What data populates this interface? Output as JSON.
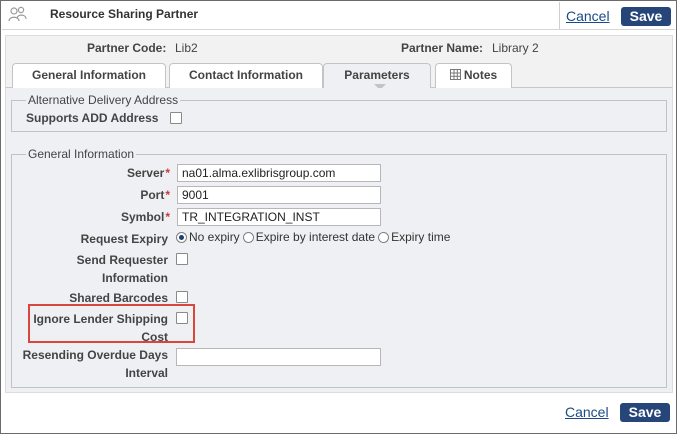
{
  "header": {
    "title": "Resource Sharing Partner",
    "cancel_label": "Cancel",
    "save_label": "Save"
  },
  "partner": {
    "code_label": "Partner Code:",
    "code_value": "Lib2",
    "name_label": "Partner Name:",
    "name_value": "Library 2"
  },
  "tabs": [
    {
      "label": "General Information"
    },
    {
      "label": "Contact Information"
    },
    {
      "label": "Parameters",
      "active": true
    },
    {
      "label": "Notes"
    }
  ],
  "alt_delivery": {
    "legend": "Alternative Delivery Address",
    "supports_add_label": "Supports ADD Address",
    "supports_add_checked": false
  },
  "general": {
    "legend": "General Information",
    "server_label": "Server",
    "server_value": "na01.alma.exlibrisgroup.com",
    "port_label": "Port",
    "port_value": "9001",
    "symbol_label": "Symbol",
    "symbol_value": "TR_INTEGRATION_INST",
    "required_marker": "*",
    "request_expiry_label": "Request Expiry",
    "request_expiry_options": [
      "No expiry",
      "Expire by interest date",
      "Expiry time"
    ],
    "request_expiry_selected": "No expiry",
    "send_requester_label_1": "Send Requester",
    "send_requester_label_2": "Information",
    "shared_barcodes_label": "Shared Barcodes",
    "ignore_lender_label_1": "Ignore Lender Shipping",
    "ignore_lender_label_2": "Cost",
    "resending_label_1": "Resending Overdue Days",
    "resending_label_2": "Interval",
    "resending_value": ""
  },
  "footer": {
    "cancel_label": "Cancel",
    "save_label": "Save"
  },
  "colors": {
    "primary": "#26467a",
    "link": "#1c4a86",
    "highlight": "#d9463d",
    "required": "#c43c3c"
  }
}
